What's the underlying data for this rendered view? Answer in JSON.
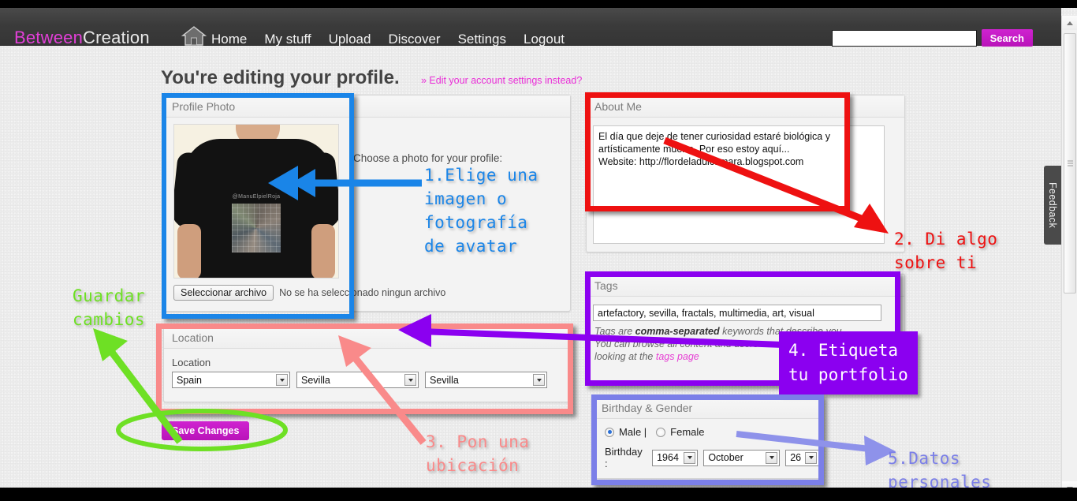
{
  "header": {
    "brand_part1": "Between",
    "brand_part2": "Creation",
    "brand_color": "#e23fd8",
    "home_icon": "home-icon",
    "nav": [
      {
        "label": "Home"
      },
      {
        "label": "My stuff"
      },
      {
        "label": "Upload"
      },
      {
        "label": "Discover"
      },
      {
        "label": "Settings"
      },
      {
        "label": "Logout"
      }
    ],
    "search": {
      "value": "",
      "placeholder": "",
      "button_label": "Search"
    }
  },
  "page": {
    "title": "You're editing your profile.",
    "settings_link": "» Edit your account settings instead?"
  },
  "profile_photo": {
    "panel_title": "Profile Photo",
    "choose_label": "Choose a photo for your profile:",
    "file_button_label": "Seleccionar archivo",
    "file_status": "No se ha seleccionado ningun archivo",
    "image_caption": "@ManuElpielRoja"
  },
  "about_me": {
    "panel_title": "About Me",
    "text": "El día que deje de tener curiosidad estaré biológica y artísticamente muerto. Por eso estoy aquí...\nWebsite: http://flordeladulcamara.blogspot.com"
  },
  "location": {
    "panel_title": "Location",
    "field_label": "Location",
    "country": "Spain",
    "region": "Sevilla",
    "city": "Sevilla"
  },
  "tags": {
    "panel_title": "Tags",
    "value": "artefactory, sevilla, fractals, multimedia, art, visual",
    "help_line1_a": "Tags are ",
    "help_line1_b": "comma-separated",
    "help_line1_c": " keywords that describe you.",
    "help_line2": "You can browse all content and users",
    "help_line3_a": "looking at the ",
    "help_link": "tags page"
  },
  "birthday_gender": {
    "panel_title": "Birthday & Gender",
    "male_label": "Male |",
    "female_label": "Female",
    "selected_gender": "Male",
    "birthday_label": "Birthday :",
    "year": "1964",
    "month": "October",
    "day": "26"
  },
  "actions": {
    "save_label": "Save Changes"
  },
  "feedback": {
    "label": "Feedback"
  },
  "annotations": [
    {
      "id": 1,
      "text": "1.Elige una\nimagen o\nfotografía\nde avatar",
      "color": "#1a85e8",
      "shape": "rectangle + arrow"
    },
    {
      "id": 2,
      "text": "2. Di algo\nsobre ti",
      "color": "#ee1111",
      "shape": "rectangle + arrow"
    },
    {
      "id": 3,
      "text": "3. Pon una\nubicación",
      "color": "#f98a8a",
      "shape": "rectangle + arrow"
    },
    {
      "id": 4,
      "text": "4. Etiqueta\ntu portfolio",
      "color": "#8b00f0",
      "shape": "rectangle + filled label + arrow"
    },
    {
      "id": 5,
      "text": "5.Datos\npersonales",
      "color": "#7b7fe8",
      "shape": "rectangle + arrow"
    },
    {
      "id": 6,
      "text": "Guardar\ncambios",
      "color": "#6ee024",
      "shape": "ellipse + arrow"
    }
  ]
}
